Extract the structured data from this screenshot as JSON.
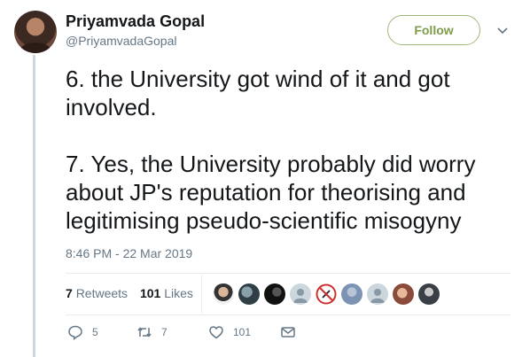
{
  "author": {
    "name": "Priyamvada Gopal",
    "handle": "@PriyamvadaGopal"
  },
  "follow_label": "Follow",
  "tweet": {
    "text": "6. the University got wind of it and got\ninvolved.\n\n7. Yes, the University probably did worry\nabout JP's reputation for theorising and\nlegitimising pseudo-scientific misogyny",
    "timestamp": "8:46 PM - 22 Mar 2019"
  },
  "stats": {
    "retweets_count": "7",
    "retweets_label": "Retweets",
    "likes_count": "101",
    "likes_label": "Likes"
  },
  "actions": {
    "reply_count": "5",
    "retweet_count": "7",
    "like_count": "101"
  },
  "colors": {
    "follow_accent": "#7d9d4b",
    "muted_text": "#657786",
    "thread_line": "#ccd6dd"
  },
  "icons": [
    "chevron-down-icon",
    "reply-icon",
    "retweet-icon",
    "like-icon",
    "message-icon"
  ]
}
